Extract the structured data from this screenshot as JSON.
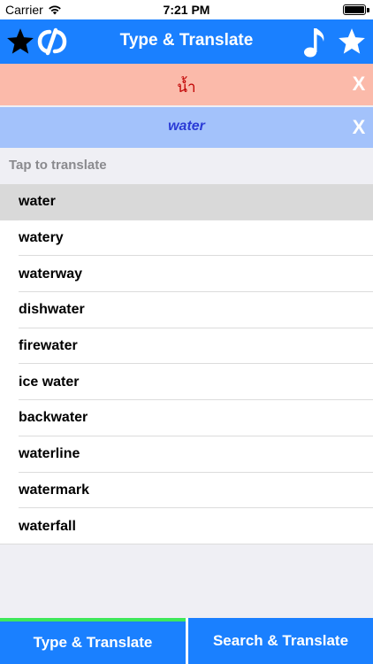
{
  "status_bar": {
    "carrier": "Carrier",
    "time": "7:21 PM"
  },
  "header": {
    "title": "Type & Translate",
    "icons": [
      "star-icon",
      "language-swap-icon",
      "music-note-icon",
      "star-icon"
    ]
  },
  "source": {
    "text": "น้ำ",
    "clear_label": "X"
  },
  "target": {
    "text": "water",
    "clear_label": "X"
  },
  "hint": "Tap to translate",
  "suggestions": [
    "water",
    "watery",
    "waterway",
    "dishwater",
    "firewater",
    "ice water",
    "backwater",
    "waterline",
    "watermark",
    "waterfall"
  ],
  "selected_index": 0,
  "tabs": [
    {
      "label": "Type & Translate",
      "active": true
    },
    {
      "label": "Search & Translate",
      "active": false
    }
  ],
  "colors": {
    "brand": "#1a80ff",
    "source_bg": "#fbbaaa",
    "target_bg": "#a3c2fb",
    "active_tab_indicator": "#3ee85a"
  }
}
